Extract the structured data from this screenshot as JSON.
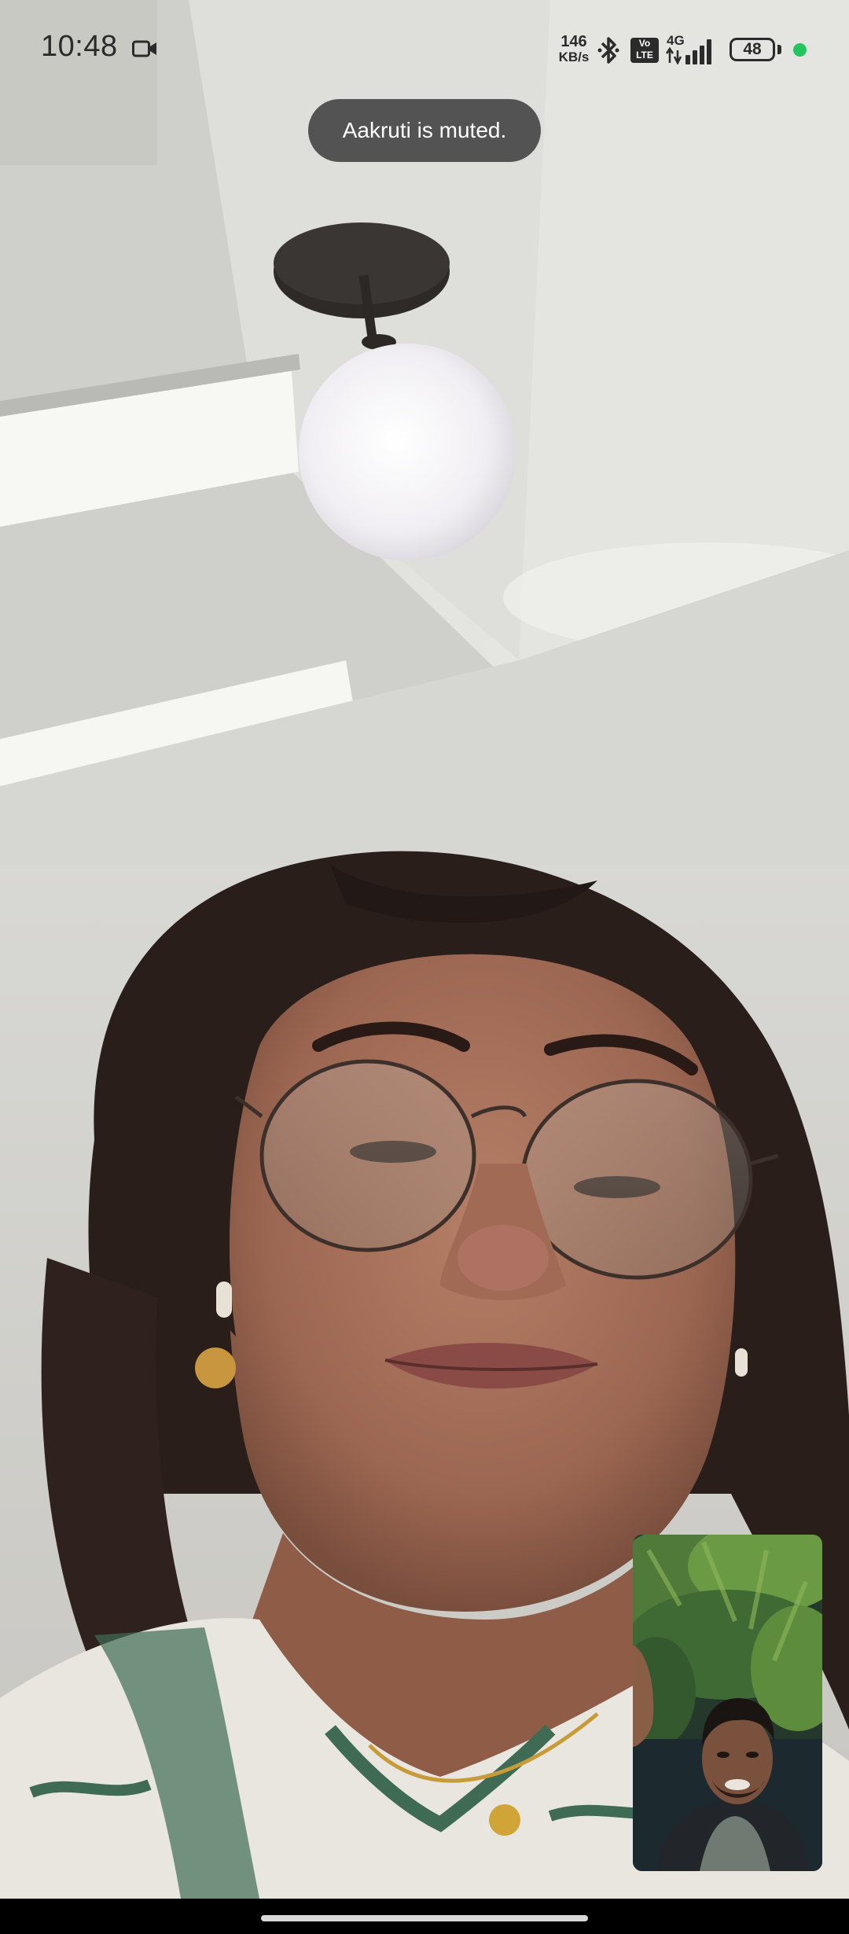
{
  "status_bar": {
    "time": "10:48",
    "net_speed_value": "146",
    "net_speed_unit": "KB/s",
    "volte_top": "Vo",
    "volte_bottom": "LTE",
    "network_type": "4G",
    "battery_level": "48",
    "privacy_indicator_color": "#22c55e",
    "icons": [
      "video-camera-icon",
      "bluetooth-icon",
      "volte-icon",
      "signal-strength-icon",
      "battery-icon"
    ]
  },
  "toast": {
    "message": "Aakruti is muted."
  },
  "colors": {
    "toast_background": "#4a4a4a",
    "status_text": "#2b2b2b"
  }
}
